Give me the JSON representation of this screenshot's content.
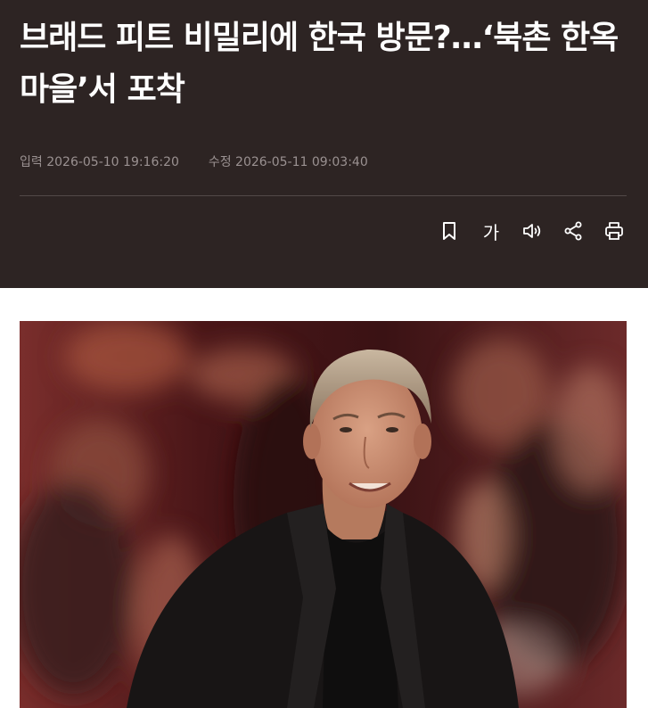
{
  "article": {
    "title": "브래드 피트 비밀리에 한국 방문?…‘북촌 한옥마을’서 포착",
    "published_label": "입력",
    "published_time": "2026-05-10 19:16:20",
    "modified_label": "수정",
    "modified_time": "2026-05-11 09:03:40"
  },
  "toolbar": {
    "font_size_label": "가",
    "icons": [
      "bookmark-icon",
      "font-size-icon",
      "speaker-icon",
      "share-icon",
      "print-icon"
    ]
  },
  "colors": {
    "header_bg": "#2d2423",
    "title_text": "#ffffff",
    "meta_text": "#9a9191",
    "divider": "#524948"
  }
}
